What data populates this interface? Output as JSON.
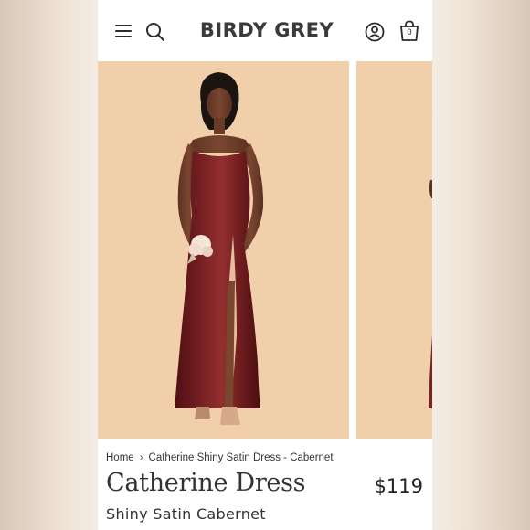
{
  "header": {
    "logo": "BIRDY GREY",
    "icons": {
      "menu": "menu-icon",
      "search": "search-icon",
      "account": "account-icon",
      "bag": "shopping-bag-icon"
    },
    "bag_count": "0"
  },
  "carousel": {
    "active_slide": "model wearing burgundy satin slip dress",
    "background_color": "#f1cfab",
    "dress_color": "#6e1a1c"
  },
  "breadcrumb": {
    "home": "Home",
    "current": "Catherine Shiny Satin Dress - Cabernet"
  },
  "product": {
    "name": "Catherine Dress",
    "price": "$119",
    "variant": "Shiny Satin Cabernet"
  }
}
